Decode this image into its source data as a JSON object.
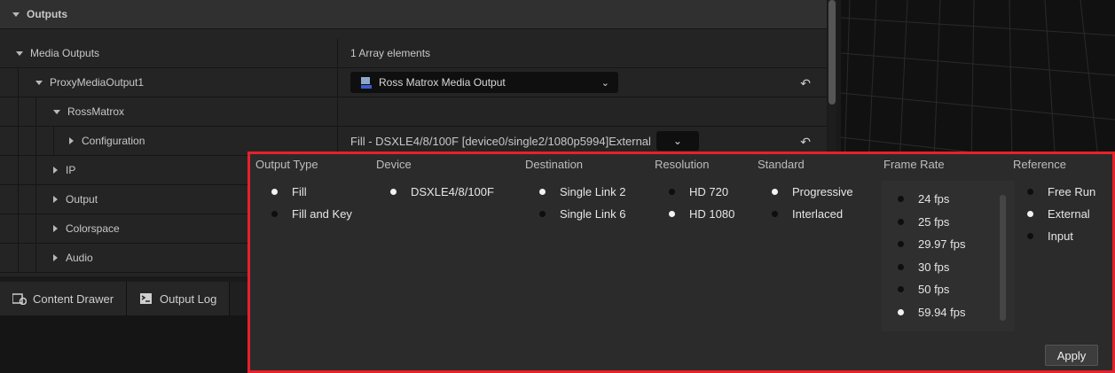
{
  "details": {
    "section_title": "Outputs",
    "media_outputs": {
      "label": "Media Outputs",
      "value": "1 Array elements"
    },
    "proxy": {
      "label": "ProxyMediaOutput1",
      "combo_value": "Ross Matrox Media Output"
    },
    "ross": {
      "label": "RossMatrox"
    },
    "configuration": {
      "label": "Configuration",
      "value": "Fill - DSXLE4/8/100F [device0/single2/1080p5994]External"
    },
    "ip": {
      "label": "IP"
    },
    "output": {
      "label": "Output"
    },
    "colorspace": {
      "label": "Colorspace"
    },
    "audio": {
      "label": "Audio"
    },
    "reset_glyph": "↶"
  },
  "bottom_tabs": [
    {
      "label": "Content Drawer",
      "icon": "content-drawer-icon"
    },
    {
      "label": "Output Log",
      "icon": "output-log-icon"
    }
  ],
  "config_popup": {
    "columns": [
      {
        "header": "Output Type",
        "items": [
          {
            "label": "Fill",
            "selected": true
          },
          {
            "label": "Fill and Key",
            "selected": false
          }
        ]
      },
      {
        "header": "Device",
        "items": [
          {
            "label": "DSXLE4/8/100F",
            "selected": true
          }
        ]
      },
      {
        "header": "Destination",
        "items": [
          {
            "label": "Single Link 2",
            "selected": true
          },
          {
            "label": "Single Link 6",
            "selected": false
          }
        ]
      },
      {
        "header": "Resolution",
        "items": [
          {
            "label": "HD 720",
            "selected": false
          },
          {
            "label": "HD 1080",
            "selected": true
          }
        ]
      },
      {
        "header": "Standard",
        "items": [
          {
            "label": "Progressive",
            "selected": true
          },
          {
            "label": "Interlaced",
            "selected": false
          }
        ]
      },
      {
        "header": "Frame Rate",
        "items": [
          {
            "label": "24 fps",
            "selected": false
          },
          {
            "label": "25 fps",
            "selected": false
          },
          {
            "label": "29.97 fps",
            "selected": false
          },
          {
            "label": "30 fps",
            "selected": false
          },
          {
            "label": "50 fps",
            "selected": false
          },
          {
            "label": "59.94 fps",
            "selected": true
          }
        ]
      },
      {
        "header": "Reference",
        "items": [
          {
            "label": "Free Run",
            "selected": false
          },
          {
            "label": "External",
            "selected": true
          },
          {
            "label": "Input",
            "selected": false
          }
        ]
      }
    ],
    "apply_label": "Apply"
  },
  "colors": {
    "highlight_border": "#e8202a",
    "panel_bg": "#242424",
    "popup_bg": "#2b2b2b"
  }
}
